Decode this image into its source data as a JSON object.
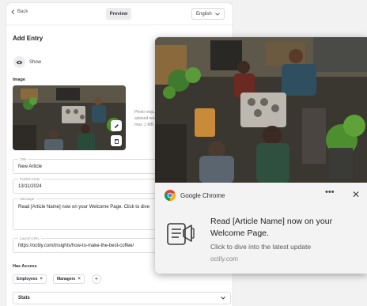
{
  "form": {
    "back_label": "Back",
    "preview_label": "Preview",
    "language": "English",
    "title": "Add Entry",
    "show_label": "Show",
    "image_section_label": "Image",
    "image_hint": "Photo requ... advised res... max. 1 MB",
    "title_field": {
      "label": "Title",
      "value": "New Article"
    },
    "date_field": {
      "label": "Publish Date",
      "value": "13/11/2024"
    },
    "message_field": {
      "label": "Message",
      "value": "Read [Article Name] now on your Welcome Page. Click to dive"
    },
    "url_field": {
      "label": "Launch URL",
      "value": "https://octily.com/insights/how-to-make-the-best-coffee/"
    },
    "access_label": "Has Access",
    "access_chips": [
      "Employees",
      "Managers"
    ],
    "stats_label": "Stats"
  },
  "notification": {
    "app_name": "Google Chrome",
    "more_icon": "more-horizontal-icon",
    "close_icon": "close-icon",
    "title": "Read [Article Name] now on your Welcome Page.",
    "body": "Click to dive into the latest update",
    "source": "octily.com"
  },
  "colors": {
    "page_bg": "#f2f2f3",
    "panel_bg": "#ffffff",
    "notification_bg": "#f3f3f3",
    "chrome_red": "#db4437",
    "chrome_yellow": "#f4b400",
    "chrome_green": "#0f9d58",
    "chrome_blue": "#4285f4"
  }
}
